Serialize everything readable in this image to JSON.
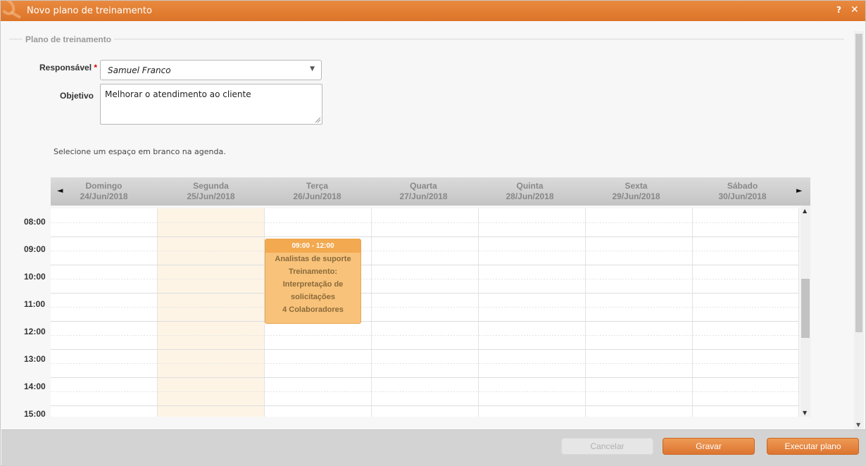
{
  "window": {
    "title": "Novo plano de treinamento",
    "help_label": "?",
    "close_label": "✕"
  },
  "form": {
    "section_label": "Plano de treinamento",
    "responsavel_label": "Responsável",
    "required_mark": "*",
    "responsavel_value": "Samuel Franco",
    "objetivo_label": "Objetivo",
    "objetivo_value": "Melhorar o atendimento ao cliente"
  },
  "calendar": {
    "hint": "Selecione um espaço em branco na agenda.",
    "prev_label": "◄",
    "next_label": "►",
    "days": [
      {
        "name": "Domingo",
        "date": "24/Jun/2018"
      },
      {
        "name": "Segunda",
        "date": "25/Jun/2018"
      },
      {
        "name": "Terça",
        "date": "26/Jun/2018"
      },
      {
        "name": "Quarta",
        "date": "27/Jun/2018"
      },
      {
        "name": "Quinta",
        "date": "28/Jun/2018"
      },
      {
        "name": "Sexta",
        "date": "29/Jun/2018"
      },
      {
        "name": "Sábado",
        "date": "30/Jun/2018"
      }
    ],
    "hours": [
      "08:00",
      "09:00",
      "10:00",
      "11:00",
      "12:00",
      "13:00",
      "14:00",
      "15:00"
    ],
    "event": {
      "time": "09:00 - 12:00",
      "line1": "Analistas de suporte",
      "line2": "Treinamento:",
      "line3": "Interpretação de",
      "line4": "solicitações",
      "line5": "4 Colaboradores"
    }
  },
  "footer": {
    "cancel_label": "Cancelar",
    "save_label": "Gravar",
    "execute_label": "Executar plano"
  },
  "colors": {
    "titlebar": "#dc7428",
    "accent": "#e98a3f",
    "event_bg": "#f8c27a",
    "today_bg": "#fdf4e6"
  }
}
